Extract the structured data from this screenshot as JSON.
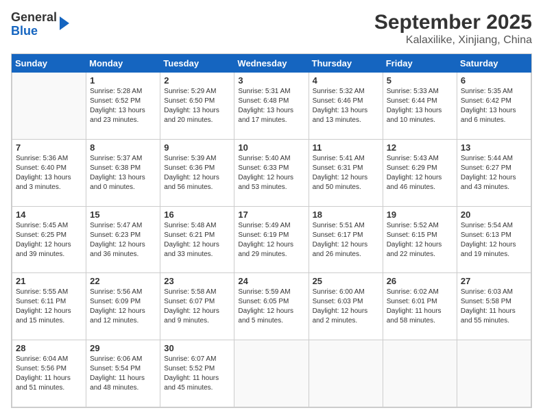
{
  "header": {
    "logo": {
      "line1": "General",
      "line2": "Blue"
    },
    "title": "September 2025",
    "subtitle": "Kalaxilike, Xinjiang, China"
  },
  "calendar": {
    "days_of_week": [
      "Sunday",
      "Monday",
      "Tuesday",
      "Wednesday",
      "Thursday",
      "Friday",
      "Saturday"
    ],
    "weeks": [
      [
        {
          "day": "",
          "info": ""
        },
        {
          "day": "1",
          "info": "Sunrise: 5:28 AM\nSunset: 6:52 PM\nDaylight: 13 hours\nand 23 minutes."
        },
        {
          "day": "2",
          "info": "Sunrise: 5:29 AM\nSunset: 6:50 PM\nDaylight: 13 hours\nand 20 minutes."
        },
        {
          "day": "3",
          "info": "Sunrise: 5:31 AM\nSunset: 6:48 PM\nDaylight: 13 hours\nand 17 minutes."
        },
        {
          "day": "4",
          "info": "Sunrise: 5:32 AM\nSunset: 6:46 PM\nDaylight: 13 hours\nand 13 minutes."
        },
        {
          "day": "5",
          "info": "Sunrise: 5:33 AM\nSunset: 6:44 PM\nDaylight: 13 hours\nand 10 minutes."
        },
        {
          "day": "6",
          "info": "Sunrise: 5:35 AM\nSunset: 6:42 PM\nDaylight: 13 hours\nand 6 minutes."
        }
      ],
      [
        {
          "day": "7",
          "info": "Sunrise: 5:36 AM\nSunset: 6:40 PM\nDaylight: 13 hours\nand 3 minutes."
        },
        {
          "day": "8",
          "info": "Sunrise: 5:37 AM\nSunset: 6:38 PM\nDaylight: 13 hours\nand 0 minutes."
        },
        {
          "day": "9",
          "info": "Sunrise: 5:39 AM\nSunset: 6:36 PM\nDaylight: 12 hours\nand 56 minutes."
        },
        {
          "day": "10",
          "info": "Sunrise: 5:40 AM\nSunset: 6:33 PM\nDaylight: 12 hours\nand 53 minutes."
        },
        {
          "day": "11",
          "info": "Sunrise: 5:41 AM\nSunset: 6:31 PM\nDaylight: 12 hours\nand 50 minutes."
        },
        {
          "day": "12",
          "info": "Sunrise: 5:43 AM\nSunset: 6:29 PM\nDaylight: 12 hours\nand 46 minutes."
        },
        {
          "day": "13",
          "info": "Sunrise: 5:44 AM\nSunset: 6:27 PM\nDaylight: 12 hours\nand 43 minutes."
        }
      ],
      [
        {
          "day": "14",
          "info": "Sunrise: 5:45 AM\nSunset: 6:25 PM\nDaylight: 12 hours\nand 39 minutes."
        },
        {
          "day": "15",
          "info": "Sunrise: 5:47 AM\nSunset: 6:23 PM\nDaylight: 12 hours\nand 36 minutes."
        },
        {
          "day": "16",
          "info": "Sunrise: 5:48 AM\nSunset: 6:21 PM\nDaylight: 12 hours\nand 33 minutes."
        },
        {
          "day": "17",
          "info": "Sunrise: 5:49 AM\nSunset: 6:19 PM\nDaylight: 12 hours\nand 29 minutes."
        },
        {
          "day": "18",
          "info": "Sunrise: 5:51 AM\nSunset: 6:17 PM\nDaylight: 12 hours\nand 26 minutes."
        },
        {
          "day": "19",
          "info": "Sunrise: 5:52 AM\nSunset: 6:15 PM\nDaylight: 12 hours\nand 22 minutes."
        },
        {
          "day": "20",
          "info": "Sunrise: 5:54 AM\nSunset: 6:13 PM\nDaylight: 12 hours\nand 19 minutes."
        }
      ],
      [
        {
          "day": "21",
          "info": "Sunrise: 5:55 AM\nSunset: 6:11 PM\nDaylight: 12 hours\nand 15 minutes."
        },
        {
          "day": "22",
          "info": "Sunrise: 5:56 AM\nSunset: 6:09 PM\nDaylight: 12 hours\nand 12 minutes."
        },
        {
          "day": "23",
          "info": "Sunrise: 5:58 AM\nSunset: 6:07 PM\nDaylight: 12 hours\nand 9 minutes."
        },
        {
          "day": "24",
          "info": "Sunrise: 5:59 AM\nSunset: 6:05 PM\nDaylight: 12 hours\nand 5 minutes."
        },
        {
          "day": "25",
          "info": "Sunrise: 6:00 AM\nSunset: 6:03 PM\nDaylight: 12 hours\nand 2 minutes."
        },
        {
          "day": "26",
          "info": "Sunrise: 6:02 AM\nSunset: 6:01 PM\nDaylight: 11 hours\nand 58 minutes."
        },
        {
          "day": "27",
          "info": "Sunrise: 6:03 AM\nSunset: 5:58 PM\nDaylight: 11 hours\nand 55 minutes."
        }
      ],
      [
        {
          "day": "28",
          "info": "Sunrise: 6:04 AM\nSunset: 5:56 PM\nDaylight: 11 hours\nand 51 minutes."
        },
        {
          "day": "29",
          "info": "Sunrise: 6:06 AM\nSunset: 5:54 PM\nDaylight: 11 hours\nand 48 minutes."
        },
        {
          "day": "30",
          "info": "Sunrise: 6:07 AM\nSunset: 5:52 PM\nDaylight: 11 hours\nand 45 minutes."
        },
        {
          "day": "",
          "info": ""
        },
        {
          "day": "",
          "info": ""
        },
        {
          "day": "",
          "info": ""
        },
        {
          "day": "",
          "info": ""
        }
      ]
    ]
  }
}
